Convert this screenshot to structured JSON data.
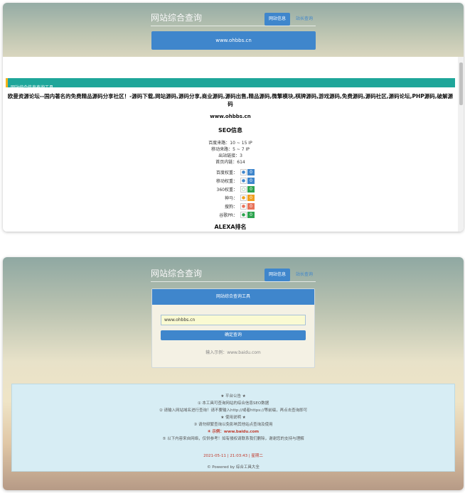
{
  "top_panel": {
    "title": "网站综合查询",
    "tab_active": "网站信息",
    "tab_other": "站长查询",
    "url_value": "www.ohbbs.cn",
    "section_bar_label": "网站综合信息查询工具",
    "site_description": "欧曼资源论坛--国内著名的免费精品源码分享社区！-源码下载,网站源码,源码分享,商业源码,源码出售,精品源码,微擎模块,棋牌源码,游戏源码,免费源码,源码社区,源码论坛,PHP源码,破解源码",
    "site_domain": "www.ohbbs.cn",
    "seo_title": "SEO信息",
    "seo_lines": [
      "百度来路：10 ~ 15 IP",
      "移动来路：5 ~ 7 IP",
      "出站链接：3",
      "首页内链：614"
    ],
    "weights": [
      {
        "label": "百度权重：",
        "icon": "baidu-icon",
        "value": "0",
        "color": "#3f86cc"
      },
      {
        "label": "移动权重：",
        "icon": "mobile-icon",
        "value": "0",
        "color": "#3f86cc"
      },
      {
        "label": "360权重：",
        "icon": "360-icon",
        "value": "0",
        "color": "#2ea44f"
      },
      {
        "label": "神马：",
        "icon": "shenma-icon",
        "value": "0",
        "color": "#f0a020"
      },
      {
        "label": "搜狗：",
        "icon": "sogou-icon",
        "value": "0",
        "color": "#e8735a"
      },
      {
        "label": "谷歌PR：",
        "icon": "google-icon",
        "value": "0",
        "color": "#2ea44f"
      }
    ],
    "alexa_title": "ALEXA排名"
  },
  "bottom_panel": {
    "title": "网站综合查询",
    "tab_active": "网站信息",
    "tab_other": "站长查询",
    "card_header": "网站综合查询工具",
    "input_value": "www.ohbbs.cn",
    "submit_label": "确定查询",
    "example_text": "输入示例：www.baidu.com",
    "notice_lines": [
      "★ 平台公告 ★",
      "① 本工具可查询网站的综合信息SEO数据",
      "② 请输入网站域名进行查询！请不要输入http://或者https://等前缀，再点击查询即可",
      "★ 使用说明 ★",
      "③ 请勿频繁查询以免影响其他站点查询及使用",
      "④ 示例：www.baidu.com",
      "⑤ 以下内容来自网络，仅供参考！如有侵权请联系我们删除，谢谢您的支持与理解"
    ],
    "date_text": "2021-05-11 | 21:03:43 | 星期二",
    "footer_text": "© Powered by 综合工具大全"
  }
}
